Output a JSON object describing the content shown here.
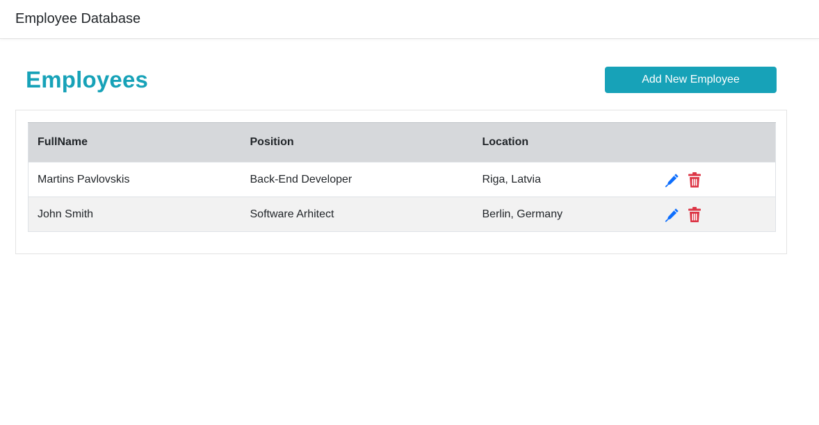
{
  "navbar": {
    "brand": "Employee Database"
  },
  "page": {
    "title": "Employees",
    "add_button_label": "Add New Employee"
  },
  "table": {
    "headers": {
      "fullname": "FullName",
      "position": "Position",
      "location": "Location"
    },
    "rows": [
      {
        "fullname": "Martins Pavlovskis",
        "position": "Back-End Developer",
        "location": "Riga, Latvia"
      },
      {
        "fullname": "John Smith",
        "position": "Software Arhitect",
        "location": "Berlin, Germany"
      }
    ],
    "row_actions": [
      "edit-pen-icon",
      "delete-trash-icon"
    ]
  },
  "colors": {
    "accent": "#17a2b8",
    "edit_icon": "#0d6efd",
    "delete_icon": "#dc3545",
    "header_bg": "#d6d8db"
  }
}
